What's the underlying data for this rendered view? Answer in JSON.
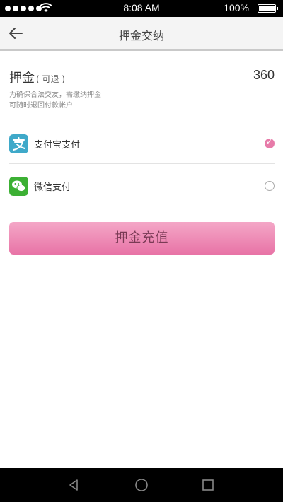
{
  "status_bar": {
    "time": "8:08 AM",
    "battery": "100%"
  },
  "nav": {
    "title": "押金交纳",
    "back_icon": "arrow-left-icon"
  },
  "deposit": {
    "label": "押金",
    "sub_label": "( 可退 )",
    "amount": "360",
    "note_line1": "为确保合法交友，需缴纳押金",
    "note_line2": "可随时退回付款帐户"
  },
  "payment": {
    "options": [
      {
        "name": "支付宝支付",
        "icon": "alipay-icon",
        "selected": true
      },
      {
        "name": "微信支付",
        "icon": "wechat-icon",
        "selected": false
      }
    ]
  },
  "submit_label": "押金充值",
  "colors": {
    "accent": "#e77ba9",
    "button_top": "#f4a7c7",
    "button_bottom": "#e873a6",
    "alipay": "#3fa9c9",
    "wechat": "#3cb034"
  },
  "system_nav": [
    "back-icon",
    "home-icon",
    "recents-icon"
  ]
}
